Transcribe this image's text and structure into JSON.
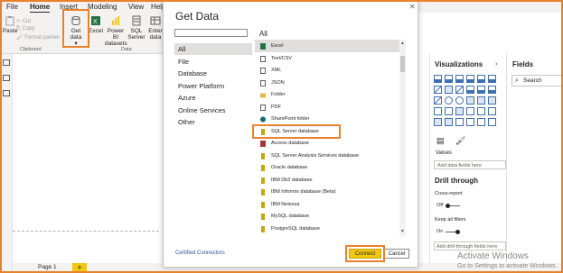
{
  "menu_tabs": [
    "File",
    "Home",
    "Insert",
    "Modeling",
    "View",
    "Help"
  ],
  "ribbon": {
    "paste": "Paste",
    "cut": "Cut",
    "copy": "Copy",
    "format_painter": "Format painter",
    "get_data": "Get data",
    "excel": "Excel",
    "power_bi_datasets": "Power BI datasets",
    "sql_server": "SQL Server",
    "enter_data": "Enter data",
    "clipboard_group": "Clipboard",
    "data_group": "Data"
  },
  "dialog": {
    "title": "Get Data",
    "categories": [
      "All",
      "File",
      "Database",
      "Power Platform",
      "Azure",
      "Online Services",
      "Other"
    ],
    "selected_category": "All",
    "list_heading": "All",
    "sources": [
      {
        "label": "Excel",
        "icon": "excel-icon"
      },
      {
        "label": "Text/CSV",
        "icon": "text-file-icon"
      },
      {
        "label": "XML",
        "icon": "xml-file-icon"
      },
      {
        "label": "JSON",
        "icon": "json-file-icon"
      },
      {
        "label": "Folder",
        "icon": "folder-icon"
      },
      {
        "label": "PDF",
        "icon": "pdf-icon"
      },
      {
        "label": "SharePoint folder",
        "icon": "sharepoint-icon"
      },
      {
        "label": "SQL Server database",
        "icon": "database-icon"
      },
      {
        "label": "Access database",
        "icon": "access-icon"
      },
      {
        "label": "SQL Server Analysis Services database",
        "icon": "database-icon"
      },
      {
        "label": "Oracle database",
        "icon": "database-icon"
      },
      {
        "label": "IBM Db2 database",
        "icon": "database-icon"
      },
      {
        "label": "IBM Informix database (Beta)",
        "icon": "database-icon"
      },
      {
        "label": "IBM Netezza",
        "icon": "database-icon"
      },
      {
        "label": "MySQL database",
        "icon": "database-icon"
      },
      {
        "label": "PostgreSQL database",
        "icon": "database-icon"
      }
    ],
    "selected_source": "Excel",
    "certified_link": "Certified Connectors",
    "connect_button": "Connect",
    "cancel_button": "Cancel",
    "colors": {
      "accent": "#f2c811",
      "highlight": "#e8822a",
      "selection": "#e1dfdd"
    }
  },
  "visualizations": {
    "title": "Visualizations",
    "values_label": "Values",
    "values_placeholder": "Add data fields here",
    "drill_title": "Drill through",
    "cross_report": "Cross-report",
    "cross_report_state": "Off",
    "keep_filters": "Keep all filters",
    "keep_filters_state": "On",
    "drill_placeholder": "Add drill-through fields here"
  },
  "fields": {
    "title": "Fields",
    "search_placeholder": "Search"
  },
  "page_bar": {
    "page_tab": "Page 1",
    "add_page": "+"
  },
  "watermark": {
    "line1": "Activate Windows",
    "line2": "Go to Settings to activate Windows."
  }
}
